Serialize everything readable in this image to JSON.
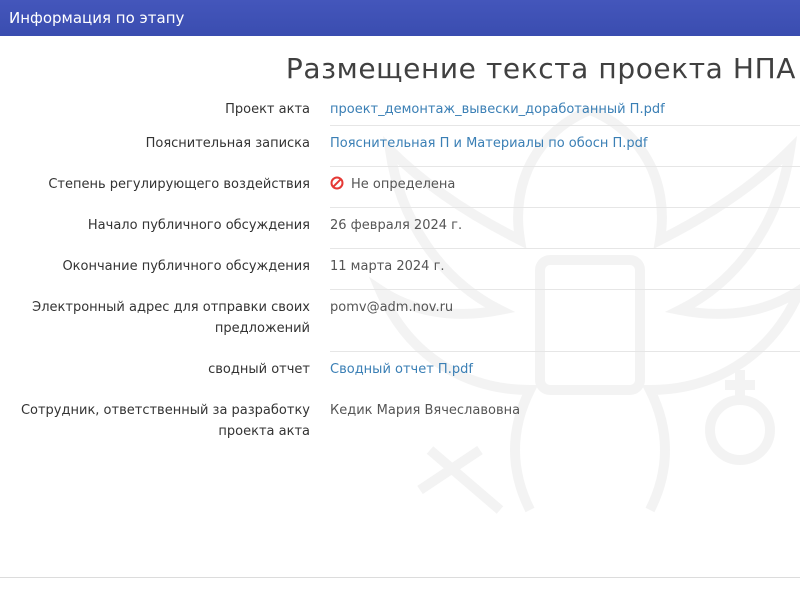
{
  "panel": {
    "title": "Информация по этапу"
  },
  "stage": {
    "title": "Размещение текста проекта НПА"
  },
  "fields": {
    "draft_act": {
      "label": "Проект акта",
      "value": "проект_демонтаж_вывески_доработанный П.pdf"
    },
    "explanatory_note": {
      "label": "Пояснительная записка",
      "value": "Пояснительная П и Материалы по обосн П.pdf"
    },
    "regulatory_impact": {
      "label": "Степень регулирующего воздействия",
      "value": "Не определена",
      "icon": "not-defined-icon",
      "icon_color": "#e53935"
    },
    "discussion_start": {
      "label": "Начало публичного обсуждения",
      "value": "26 февраля 2024 г."
    },
    "discussion_end": {
      "label": "Окончание публичного обсуждения",
      "value": "11 марта 2024 г."
    },
    "email": {
      "label": "Электронный адрес для отправки своих предложений",
      "value": "pomv@adm.nov.ru"
    },
    "summary_report": {
      "label": "сводный отчет",
      "value": "Сводный отчет П.pdf"
    },
    "responsible": {
      "label": "Сотрудник, ответственный за разработку проекта акта",
      "value": "Кедик Мария Вячеславовна"
    }
  },
  "colors": {
    "header_bg": "#3f51b5",
    "link": "#3a7fb5",
    "text": "#555555"
  }
}
